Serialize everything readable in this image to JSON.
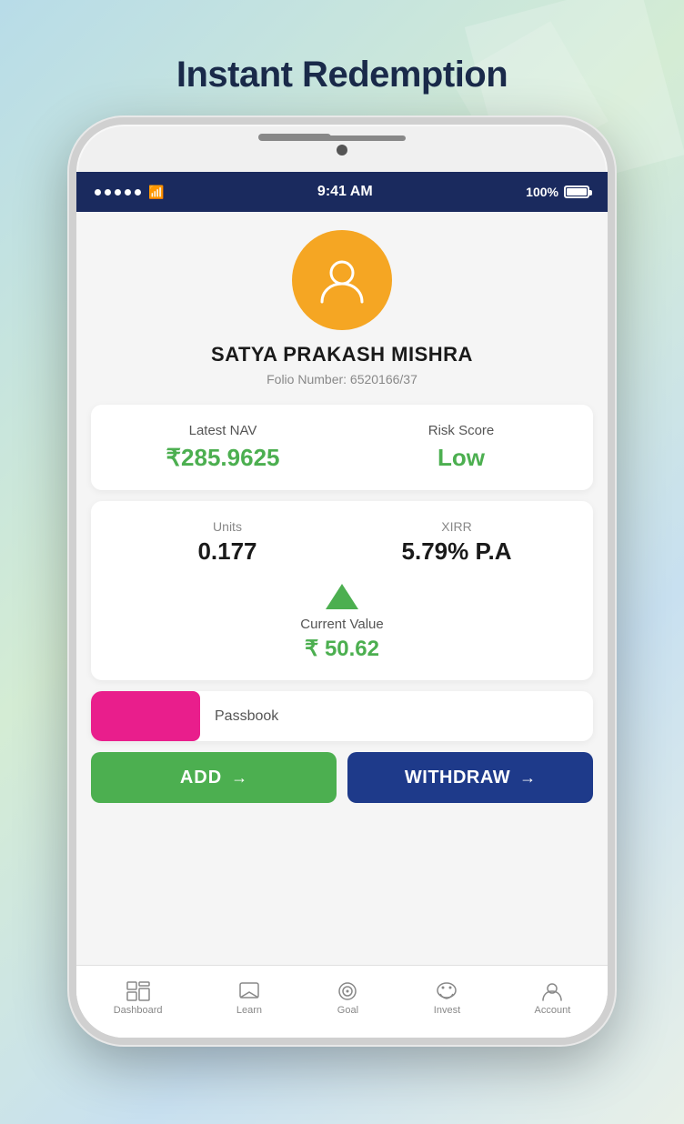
{
  "page": {
    "title": "Instant Redemption",
    "background_colors": [
      "#b8dce8",
      "#d4ecd4",
      "#c8e0f0"
    ]
  },
  "status_bar": {
    "time": "9:41 AM",
    "battery": "100%",
    "signal_dots": 5
  },
  "profile": {
    "name": "SATYA PRAKASH MISHRA",
    "folio_label": "Folio Number: 6520166/37"
  },
  "nav_card": {
    "latest_nav_label": "Latest NAV",
    "latest_nav_value": "₹285.9625",
    "risk_score_label": "Risk Score",
    "risk_score_value": "Low"
  },
  "units_card": {
    "units_label": "Units",
    "units_value": "0.177",
    "xirr_label": "XIRR",
    "xirr_value": "5.79% P.A",
    "current_value_label": "Current Value",
    "current_value": "₹ 50.62"
  },
  "passbook": {
    "label": "Passbook"
  },
  "buttons": {
    "add": "ADD",
    "withdraw": "WITHDRAW"
  },
  "bottom_nav": {
    "items": [
      {
        "label": "Dashboard",
        "icon": "⊞"
      },
      {
        "label": "Learn",
        "icon": "⬜"
      },
      {
        "label": "Goal",
        "icon": "◎"
      },
      {
        "label": "Invest",
        "icon": "🐷"
      },
      {
        "label": "Account",
        "icon": "👤"
      }
    ]
  }
}
